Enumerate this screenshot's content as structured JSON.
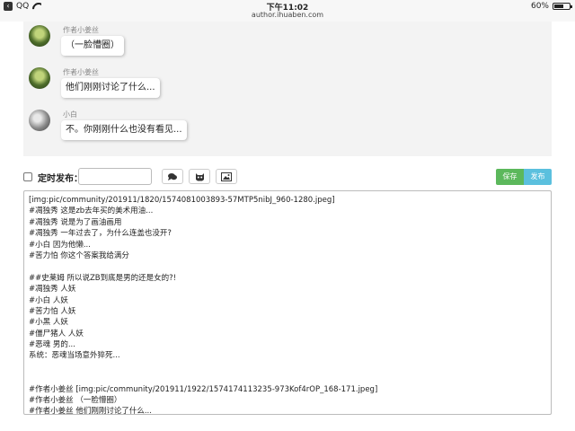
{
  "statusbar": {
    "back_label": "QQ",
    "time": "下午11:02",
    "url": "author.ihuaben.com",
    "battery": "60%",
    "battery_level": 0.6
  },
  "chat": {
    "messages": [
      {
        "author": "作者小姜丝",
        "text": "（一脸懵圈）"
      },
      {
        "author": "作者小姜丝",
        "text": "他们刚刚讨论了什么..."
      },
      {
        "author": "小白",
        "text": "不。你刚刚什么也没有看见..."
      }
    ]
  },
  "controls": {
    "timer_label": "定时发布：",
    "time_value": "",
    "save_label": "保存",
    "publish_label": "发布"
  },
  "editor": {
    "lines": [
      "[img:pic/community/201911/1820/1574081003893-57MTP5nibJ_960-1280.jpeg]",
      "#凋独秀 这是zb去年买的美术用油...",
      "#凋独秀 说是为了画油画用",
      "#凋独秀 一年过去了，为什么连盖也没开?",
      "#小白 因为他懒...",
      "#苦力怕 你这个答案我给满分",
      "",
      "##史莱姆 所以说ZB到底是男的还是女的?!",
      "#凋独秀 人妖",
      "#小白 人妖",
      "#苦力怕 人妖",
      "#小黑 人妖",
      "#僵尸猪人 人妖",
      "#恶魂 男的...",
      "系统：恶魂当场意外猝死...",
      "",
      "",
      "#作者小姜丝 [img:pic/community/201911/1922/1574174113235-973Kof4rOP_168-171.jpeg]",
      "#作者小姜丝 （一脸懵圈）",
      "#作者小姜丝 他们刚刚讨论了什么..."
    ]
  }
}
